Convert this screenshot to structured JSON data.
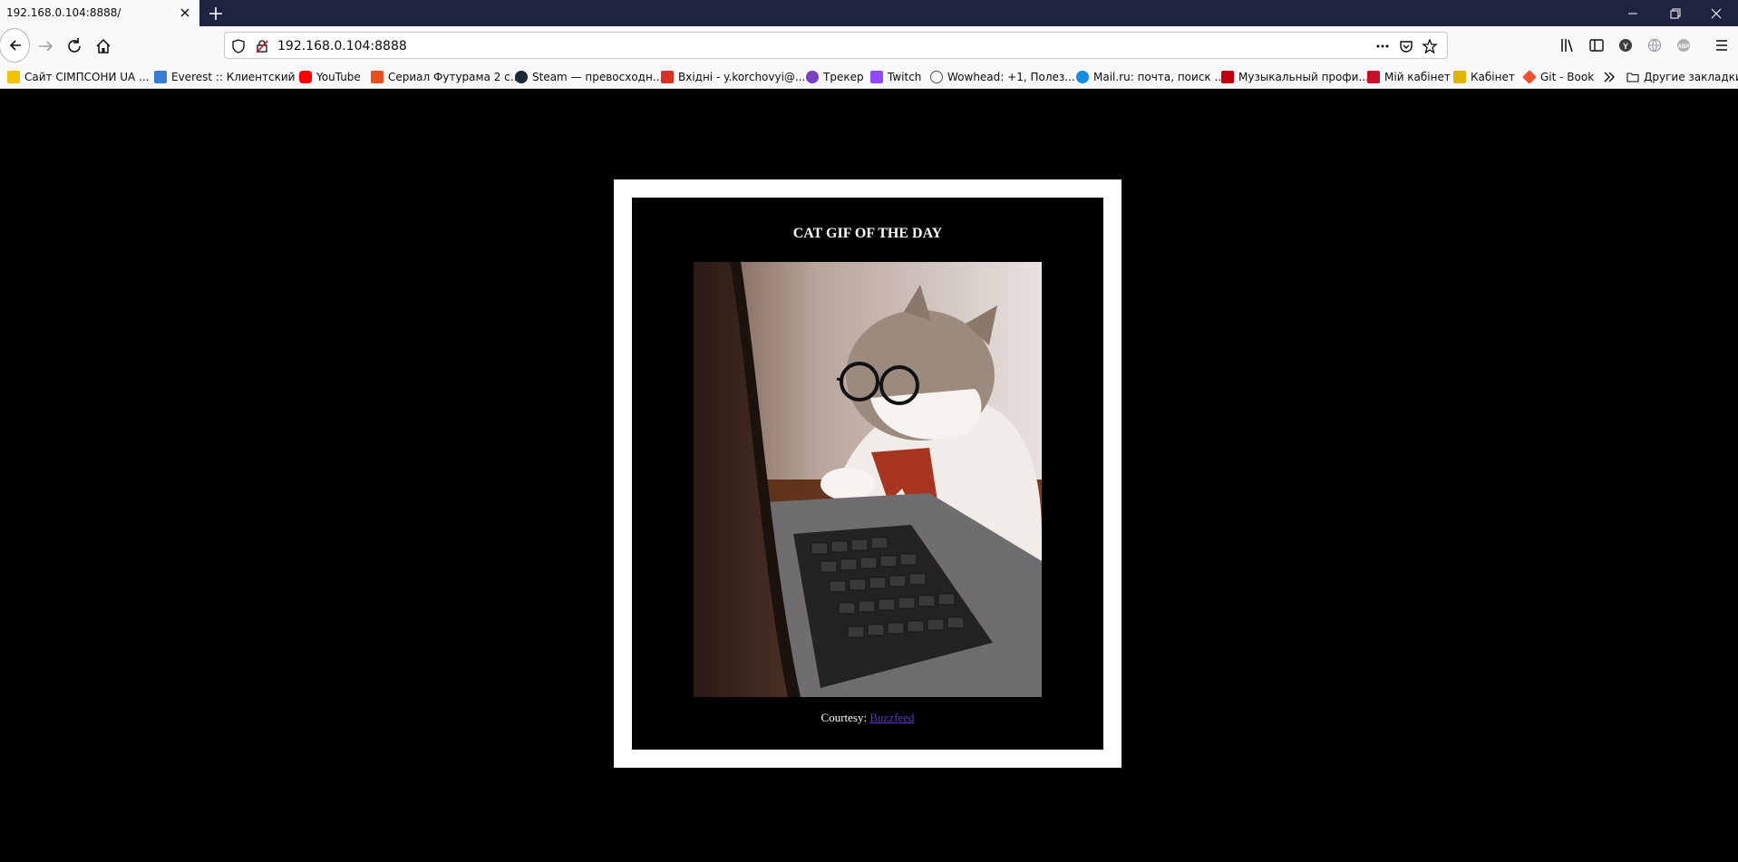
{
  "browser": {
    "tab": {
      "title": "192.168.0.104:8888/"
    },
    "address_bar": {
      "url": "192.168.0.104:8888"
    },
    "bookmarks": [
      {
        "label": "Сайт СІМПСОНИ UA ...",
        "icon": "simpsons-favicon",
        "color": "#f2c200"
      },
      {
        "label": "Everest :: Клиентский ...",
        "icon": "everest-favicon",
        "color": "#3a7bd5"
      },
      {
        "label": "YouTube",
        "icon": "youtube-favicon",
        "color": "#ff0000"
      },
      {
        "label": "Сериал Футурама 2 с...",
        "icon": "futurama-favicon",
        "color": "#e8511e"
      },
      {
        "label": "Steam — превосходн...",
        "icon": "steam-favicon",
        "color": "#1b2838"
      },
      {
        "label": "Вхідні - y.korchovyi@...",
        "icon": "gmail-favicon",
        "color": "#d93025"
      },
      {
        "label": "Трекер",
        "icon": "tracker-favicon",
        "color": "#7b3fc4"
      },
      {
        "label": "Twitch",
        "icon": "twitch-favicon",
        "color": "#9146ff"
      },
      {
        "label": "Wowhead: +1, Полез...",
        "icon": "globe-favicon",
        "color": "#555555"
      },
      {
        "label": "Mail.ru: почта, поиск ...",
        "icon": "mailru-favicon",
        "color": "#168de2"
      },
      {
        "label": "Музыкальный профи...",
        "icon": "lastfm-favicon",
        "color": "#c3000d"
      },
      {
        "label": "Мій кабінет",
        "icon": "cabinet-favicon",
        "color": "#c8102e"
      },
      {
        "label": "Кабінет",
        "icon": "cabinet2-favicon",
        "color": "#e0b400"
      },
      {
        "label": "Git - Book",
        "icon": "git-favicon",
        "color": "#f05033"
      }
    ],
    "other_bookmarks": "Другие закладки"
  },
  "page": {
    "heading": "CAT GIF OF THE DAY",
    "courtesy_label": "Courtesy:",
    "courtesy_link": "Buzzfeed",
    "link_color": "#5b34c9"
  }
}
